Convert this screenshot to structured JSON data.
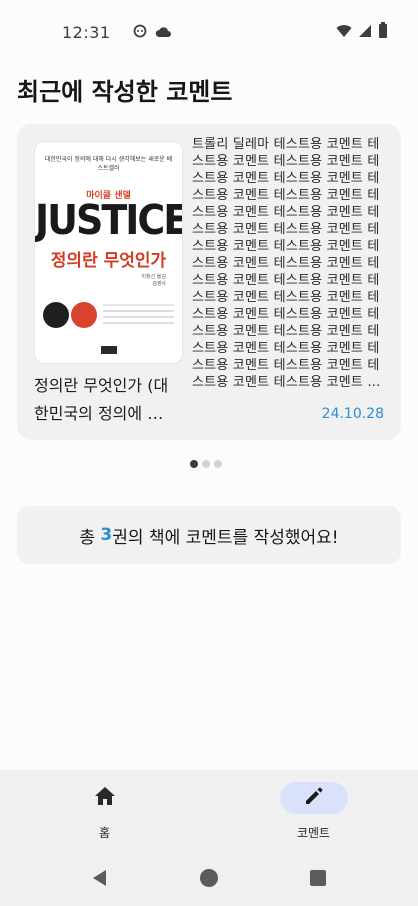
{
  "status_bar": {
    "time": "12:31",
    "icons": [
      "face-icon",
      "cloud-icon",
      "wifi-icon",
      "signal-icon",
      "battery-icon"
    ]
  },
  "page": {
    "title": "최근에 작성한 코멘트"
  },
  "carousel": {
    "item": {
      "cover": {
        "subtitle": "대한민국이 정의에 대해 다시 생각해보는 새로운 베스트셀러",
        "author": "마이클 샌델",
        "title_en": "JUSTICE",
        "title_ko": "정의란 무엇인가",
        "translator": "이창신 옮김\n김영사"
      },
      "book_title": "정의란 무엇인가 (대\n한민국의 정의에 …",
      "comment": "트롤리 딜레마 테스트용 코멘트 테\n스트용 코멘트 테스트용 코멘트 테\n스트용 코멘트 테스트용 코멘트 테\n스트용 코멘트 테스트용 코멘트 테\n스트용 코멘트 테스트용 코멘트 테\n스트용 코멘트 테스트용 코멘트 테\n스트용 코멘트 테스트용 코멘트 테\n스트용 코멘트 테스트용 코멘트 테\n스트용 코멘트 테스트용 코멘트 테\n스트용 코멘트 테스트용 코멘트 테\n스트용 코멘트 테스트용 코멘트 테\n스트용 코멘트 테스트용 코멘트 테\n스트용 코멘트 테스트용 코멘트 테\n스트용 코멘트 테스트용 코멘트 테\n스트용 코멘트 테스트용 코멘트 …",
      "date": "24.10.28"
    },
    "page_count": 3,
    "active_index": 0
  },
  "summary": {
    "prefix": "총 ",
    "count": "3",
    "suffix": "권의 책에 코멘트를 작성했어요!"
  },
  "bottom_nav": {
    "items": [
      {
        "label": "홈",
        "icon": "home-icon",
        "active": false
      },
      {
        "label": "코멘트",
        "icon": "pencil-icon",
        "active": true
      }
    ]
  },
  "system_nav": {
    "icons": [
      "back-icon",
      "home-circle-icon",
      "recents-icon"
    ]
  },
  "colors": {
    "accent": "#2c8fd0",
    "card_bg": "#f1f1f2",
    "nav_active_pill": "#d9e2fa"
  }
}
